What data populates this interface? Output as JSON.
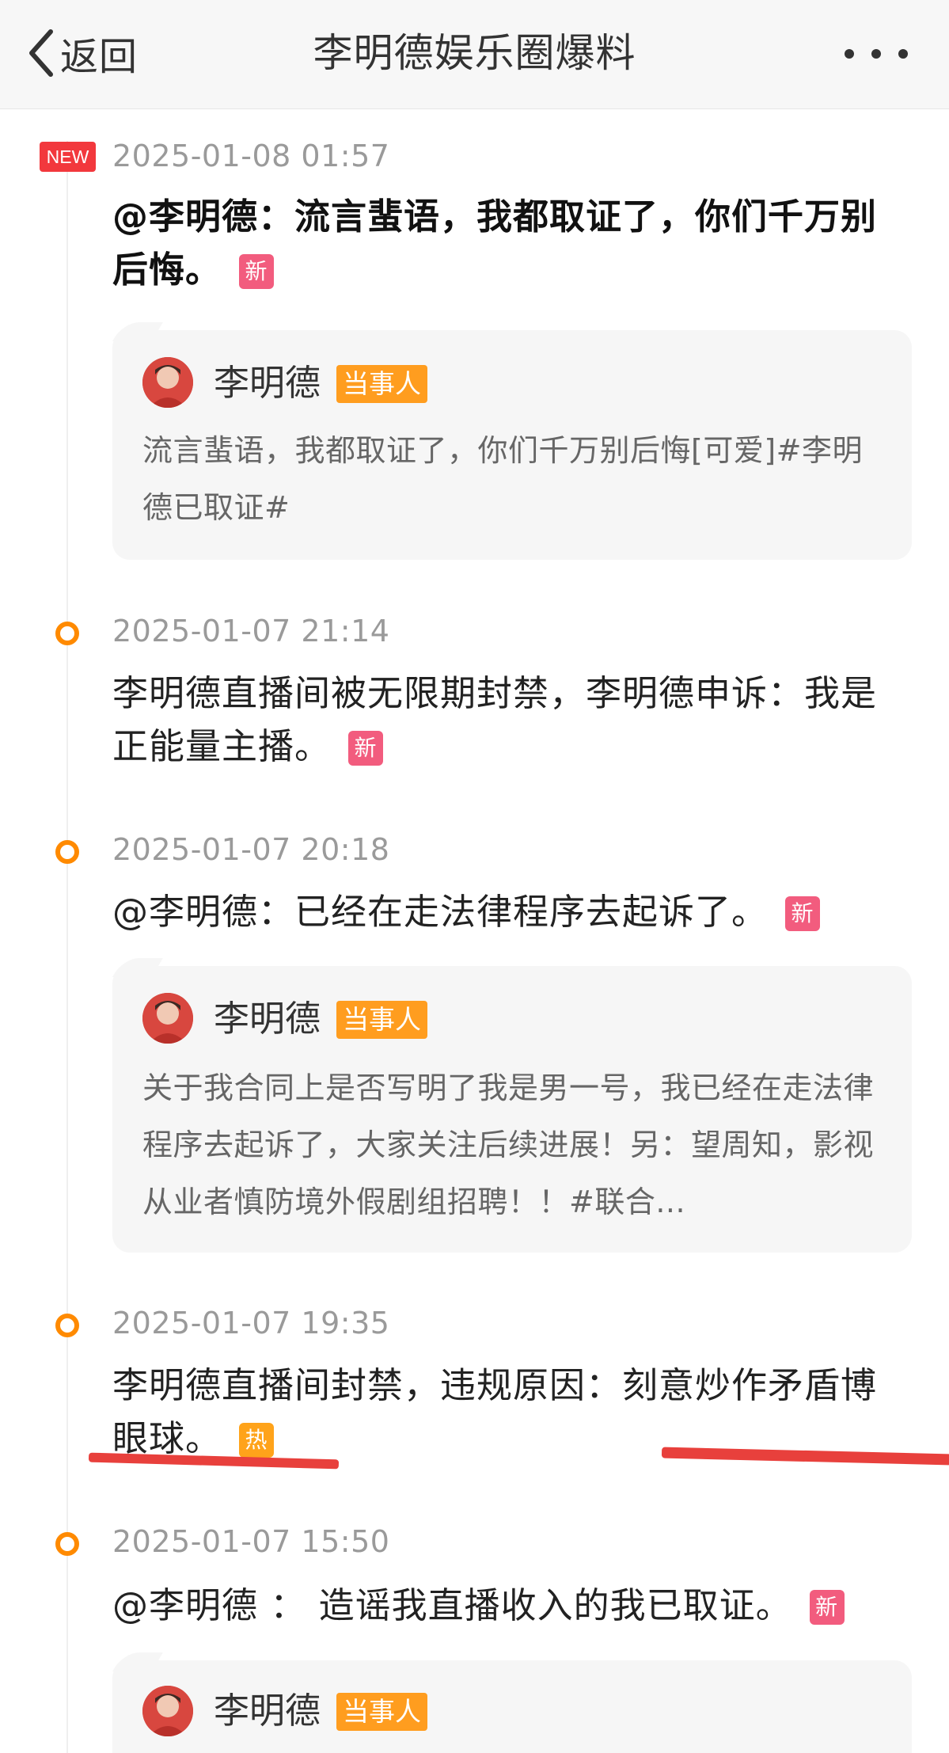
{
  "navbar": {
    "back_label": "返回",
    "title": "李明德娱乐圈爆料",
    "more_icon": "more-dots-icon"
  },
  "colors": {
    "accent_orange": "#ff8a00",
    "new_badge_red": "#f2383d",
    "tag_new_pink": "#f25c7e",
    "tag_hot_orange": "#ffa31a",
    "role_badge_orange": "#ff9d1f",
    "annotation_red": "#e8403c"
  },
  "items": [
    {
      "badge": "NEW",
      "time": "2025-01-08 01:57",
      "headline": "@李明德：流言蜚语，我都取证了，你们千万别后悔。",
      "tag": "新",
      "quote": {
        "name": "李明德",
        "role": "当事人",
        "text": "流言蜚语，我都取证了，你们千万别后悔[可爱]#李明德已取证#"
      }
    },
    {
      "time": "2025-01-07 21:14",
      "headline": "李明德直播间被无限期封禁，李明德申诉：我是正能量主播。",
      "tag": "新"
    },
    {
      "time": "2025-01-07 20:18",
      "headline": "@李明德：已经在走法律程序去起诉了。",
      "tag": "新",
      "quote": {
        "name": "李明德",
        "role": "当事人",
        "text": "关于我合同上是否写明了我是男一号，我已经在走法律程序去起诉了，大家关注后续进展！另：望周知，影视从业者慎防境外假剧组招聘！！#联合..."
      }
    },
    {
      "time": "2025-01-07 19:35",
      "headline": "李明德直播间封禁，违规原因：刻意炒作矛盾博眼球。",
      "tag": "热"
    },
    {
      "time": "2025-01-07 15:50",
      "headline": "@李明德 ： 造谣我直播收入的我已取证。",
      "tag": "新",
      "quote": {
        "name": "李明德",
        "role": "当事人",
        "text": ""
      }
    }
  ]
}
